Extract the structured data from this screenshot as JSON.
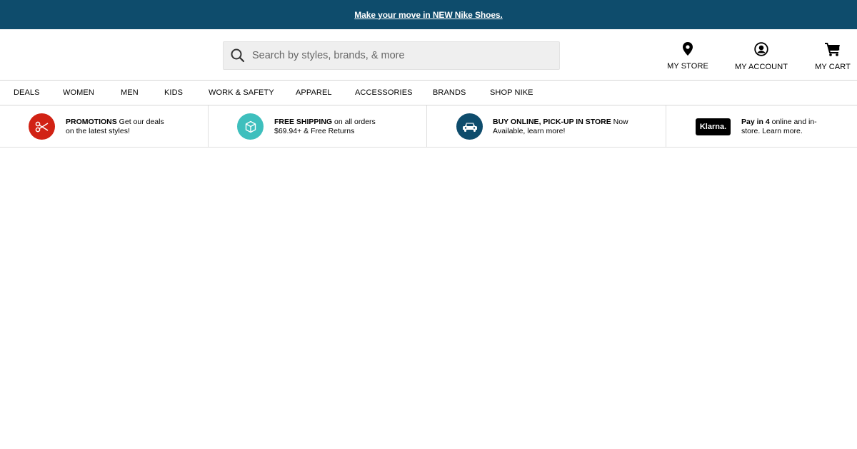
{
  "announcement": {
    "text": "Make your move in NEW Nike Shoes."
  },
  "search": {
    "placeholder": "Search by styles, brands, & more"
  },
  "utility": {
    "store_label": "MY STORE",
    "account_label": "MY ACCOUNT",
    "cart_label": "MY CART"
  },
  "nav": {
    "items": [
      {
        "label": "DEALS"
      },
      {
        "label": "WOMEN"
      },
      {
        "label": "MEN"
      },
      {
        "label": "KIDS"
      },
      {
        "label": "WORK & SAFETY"
      },
      {
        "label": "APPAREL"
      },
      {
        "label": "ACCESSORIES"
      },
      {
        "label": "BRANDS"
      },
      {
        "label": "SHOP NIKE"
      }
    ]
  },
  "promos": [
    {
      "title": "PROMOTIONS",
      "text_line1": " Get our deals",
      "text_line2": "on the latest styles!",
      "icon": "scissors-icon",
      "color": "#d12214"
    },
    {
      "title": "FREE SHIPPING",
      "text_line1": " on all orders",
      "text_line2": "$69.94+ & Free Returns",
      "icon": "box-icon",
      "color": "#3ebfbd"
    },
    {
      "title": "BUY ONLINE, PICK-UP IN STORE",
      "text_line1": " Now",
      "text_line2": "Available, learn more!",
      "icon": "car-icon",
      "color": "#0e4c6c"
    },
    {
      "title": "Pay in 4",
      "text_line1": " online and in-",
      "text_line2": "store. Learn more.",
      "icon": "klarna-logo",
      "badge": "Klarna."
    }
  ]
}
